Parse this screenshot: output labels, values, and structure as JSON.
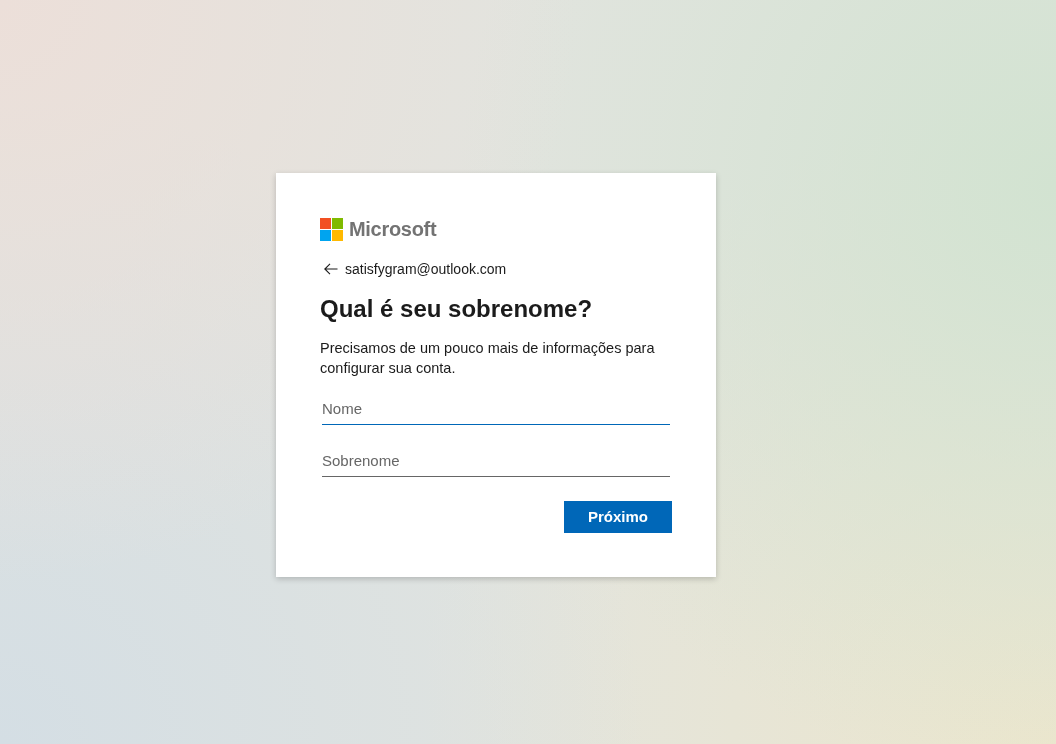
{
  "logo": {
    "text": "Microsoft"
  },
  "identity": {
    "email": "satisfygram@outlook.com"
  },
  "title": "Qual é seu sobrenome?",
  "description": "Precisamos de um pouco mais de informações para configurar sua conta.",
  "fields": [
    {
      "placeholder": "Nome",
      "focused": true
    },
    {
      "placeholder": "Sobrenome",
      "focused": false
    }
  ],
  "buttons": [
    {
      "label": "Próximo",
      "kind": "primary"
    }
  ]
}
